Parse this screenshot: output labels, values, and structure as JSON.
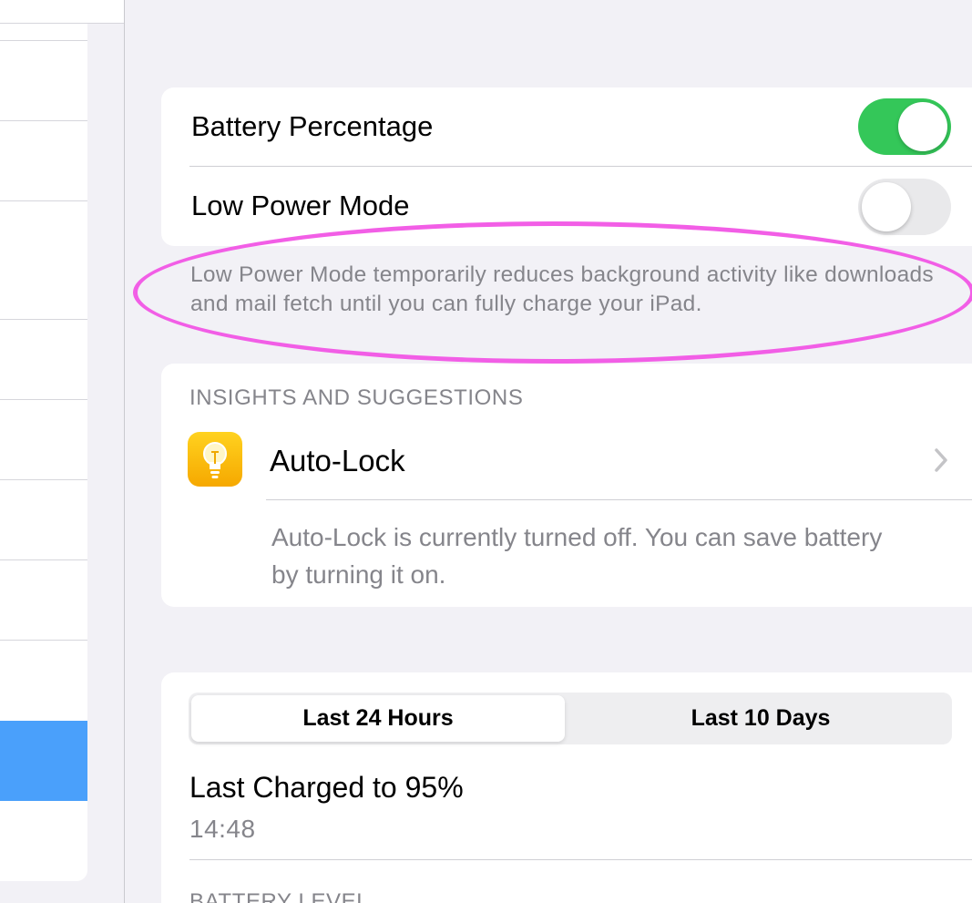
{
  "settings": {
    "battery_percentage": {
      "label": "Battery Percentage",
      "enabled": true
    },
    "low_power_mode": {
      "label": "Low Power Mode",
      "enabled": false
    },
    "low_power_footer": "Low Power Mode temporarily reduces background activity like downloads and mail fetch until you can fully charge your iPad."
  },
  "insights": {
    "header": "INSIGHTS AND SUGGESTIONS",
    "item": {
      "icon": "lightbulb-icon",
      "title": "Auto-Lock",
      "description": "Auto-Lock is currently turned off. You can save battery by turning it on."
    }
  },
  "usage": {
    "segments": [
      "Last 24 Hours",
      "Last 10 Days"
    ],
    "selected_segment": "Last 24 Hours",
    "last_charged": "Last Charged to 95%",
    "last_charged_time": "14:48",
    "battery_level_header": "BATTERY LEVEL"
  },
  "colors": {
    "toggle_on": "#34c759",
    "annotation": "#f25ee6",
    "sidebar_selected": "#4aa0fb"
  }
}
